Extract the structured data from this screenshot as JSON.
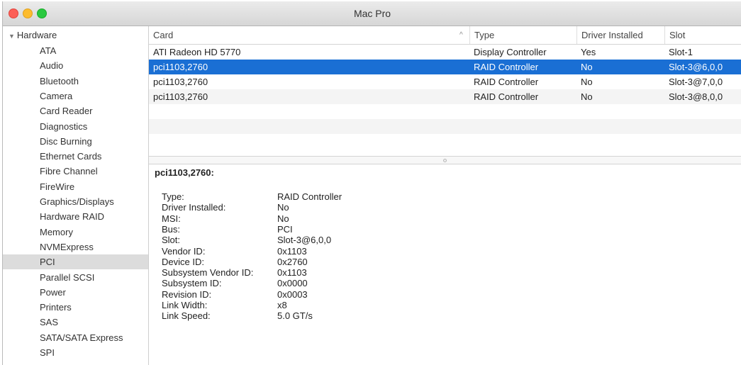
{
  "window": {
    "title": "Mac Pro"
  },
  "sidebar": {
    "header": "Hardware",
    "items": [
      {
        "label": "ATA"
      },
      {
        "label": "Audio"
      },
      {
        "label": "Bluetooth"
      },
      {
        "label": "Camera"
      },
      {
        "label": "Card Reader"
      },
      {
        "label": "Diagnostics"
      },
      {
        "label": "Disc Burning"
      },
      {
        "label": "Ethernet Cards"
      },
      {
        "label": "Fibre Channel"
      },
      {
        "label": "FireWire"
      },
      {
        "label": "Graphics/Displays"
      },
      {
        "label": "Hardware RAID"
      },
      {
        "label": "Memory"
      },
      {
        "label": "NVMExpress"
      },
      {
        "label": "PCI",
        "selected": true
      },
      {
        "label": "Parallel SCSI"
      },
      {
        "label": "Power"
      },
      {
        "label": "Printers"
      },
      {
        "label": "SAS"
      },
      {
        "label": "SATA/SATA Express"
      },
      {
        "label": "SPI"
      }
    ]
  },
  "table": {
    "columns": [
      "Card",
      "Type",
      "Driver Installed",
      "Slot"
    ],
    "sort_indicator": "^",
    "rows": [
      {
        "card": "ATI Radeon HD 5770",
        "type": "Display Controller",
        "driver": "Yes",
        "slot": "Slot-1"
      },
      {
        "card": "pci1103,2760",
        "type": "RAID Controller",
        "driver": "No",
        "slot": "Slot-3@6,0,0",
        "selected": true
      },
      {
        "card": "pci1103,2760",
        "type": "RAID Controller",
        "driver": "No",
        "slot": "Slot-3@7,0,0"
      },
      {
        "card": "pci1103,2760",
        "type": "RAID Controller",
        "driver": "No",
        "slot": "Slot-3@8,0,0"
      }
    ]
  },
  "detail": {
    "title": "pci1103,2760:",
    "fields": [
      {
        "key": "Type:",
        "value": "RAID Controller"
      },
      {
        "key": "Driver Installed:",
        "value": "No"
      },
      {
        "key": "MSI:",
        "value": "No"
      },
      {
        "key": "Bus:",
        "value": "PCI"
      },
      {
        "key": "Slot:",
        "value": "Slot-3@6,0,0"
      },
      {
        "key": "Vendor ID:",
        "value": "0x1103"
      },
      {
        "key": "Device ID:",
        "value": "0x2760"
      },
      {
        "key": "Subsystem Vendor ID:",
        "value": "0x1103"
      },
      {
        "key": "Subsystem ID:",
        "value": "0x0000"
      },
      {
        "key": "Revision ID:",
        "value": "0x0003"
      },
      {
        "key": "Link Width:",
        "value": "x8"
      },
      {
        "key": "Link Speed:",
        "value": "5.0 GT/s"
      }
    ]
  },
  "colors": {
    "selection": "#1a6fd4",
    "sidebar_selection": "#dcdcdc"
  }
}
